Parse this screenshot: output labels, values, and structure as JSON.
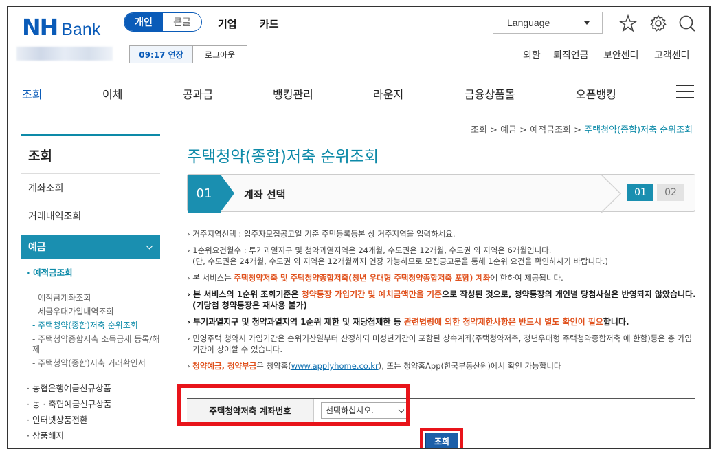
{
  "header": {
    "logo_nh": "NH",
    "logo_bank": "Bank",
    "segment": [
      "개인",
      "큰글"
    ],
    "topnav": [
      "기업",
      "카드"
    ],
    "language": "Language",
    "session_time": "09:17 연장",
    "logout": "로그아웃",
    "util_links": [
      "외환",
      "퇴직연금",
      "보안센터",
      "고객센터"
    ]
  },
  "gnb": [
    "조회",
    "이체",
    "공과금",
    "뱅킹관리",
    "라운지",
    "금융상품몰",
    "오픈뱅킹"
  ],
  "breadcrumb": [
    "조회",
    "예금",
    "예적금조회",
    "주택청약(종합)저축 순위조회"
  ],
  "breadcrumb_sep": ">",
  "sidebar": {
    "title": "조회",
    "items": [
      "계좌조회",
      "거래내역조회"
    ],
    "group": "예금",
    "sub_active": "· 예적금조회",
    "sub2": [
      "- 예적금계좌조회",
      "- 세금우대가입내역조회",
      "- 주택청약(종합)저축 순위조회",
      "- 주택청약종합저축 소득공제 등록/해제",
      "- 주택청약(종합)저축 거래확인서"
    ],
    "misc": [
      "· 농협은행예금신규상품",
      "· 농 · 축협예금신규상품",
      "· 인터넷상품전환",
      "· 상품해지"
    ]
  },
  "page_title": "주택청약(종합)저축 순위조회",
  "step": {
    "num": "01",
    "label": "계좌 선택",
    "pages": [
      "01",
      "02"
    ]
  },
  "notes": {
    "n1": "› 거주지역선택 : 입주자모집공고일 기준 주민등록등본 상 거주지역을 입력하세요.",
    "n2a": "› 1순위요건월수 : 투기과열지구 및 청약과열지역은 24개월, 수도권은 12개월, 수도권 외 지역은 6개월입니다.",
    "n2b": "(단, 수도권은 24개월, 수도권 외 지역은 12개월까지 연장 가능하므로 모집공고문을 통해 1순위 요건을 확인하시기 바랍니다.)",
    "n3_pre": "› 본 서비스는 ",
    "n3_hl": "주택청약저축 및 주택청약종합저축(청년 우대형 주택청약종합저축 포함) 계좌",
    "n3_post": "에 한하여 제공됩니다.",
    "n4_pre": "› 본 서비스의 1순위 조회기준은 ",
    "n4_hl": "청약통장 가입기간 및 예치금액만을 기준",
    "n4_post": "으로 작성된 것으로, 청약통장의 개인별 당첨사실은 반영되지 않았습니다. (기당첨 청약통장은 재사용 불가)",
    "n5_pre": "› 투기과열지구 및 청약과열지역 1순위 제한 및 재당첨제한 등 ",
    "n5_hl": "관련법령에 의한 청약제한사항은 반드시 별도 확인이 필요",
    "n5_post": "합니다.",
    "n6": "› 민영주택 청약시 가입기간은 순위기산일부터 산정하되 미성년기간이 포함된 상속계좌(주택청약저축, 청년우대형 주택청약종합저축 에 한함)등은 총 가입기간이 상이할 수 있습니다.",
    "n7_arrow": "› ",
    "n7_hl": "청약예금, 청약부금",
    "n7_mid": "은 청약홈(",
    "n7_link": "www.applyhome.co.kr",
    "n7_post": "), 또는 청약홈App(한국부동산원)에서 확인 가능합니다"
  },
  "form": {
    "label": "주택청약저축 계좌번호",
    "select_value": "선택하십시오."
  },
  "submit": "조회",
  "colors": {
    "brand": "#0a5bb8",
    "accent": "#1a8fb0",
    "highlight": "#e0521e",
    "annotation": "#e8141a"
  }
}
